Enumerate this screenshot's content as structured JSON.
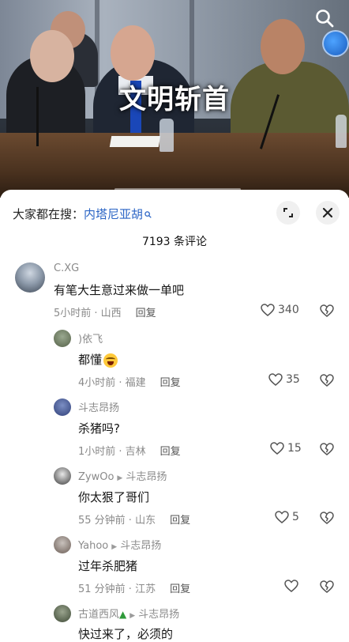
{
  "video": {
    "overlay_title": "文明斩首",
    "icons": [
      "search-icon",
      "avatar-badge"
    ]
  },
  "sheet": {
    "search_prefix": "大家都在搜：",
    "search_term": "内塔尼亚胡",
    "comment_count": "7193 条评论",
    "icons": [
      "expand-icon",
      "close-icon"
    ]
  },
  "comments": [
    {
      "user": "C.XG",
      "text": "有笔大生意过来做一单吧",
      "time": "5小时前 · 山西",
      "reply": "回复",
      "likes": "340"
    },
    {
      "user": ")依飞",
      "text": "都懂",
      "time": "4小时前 · 福建",
      "reply": "回复",
      "likes": "35"
    },
    {
      "user": "斗志昂扬",
      "text": "杀猪吗?",
      "time": "1小时前 · 吉林",
      "reply": "回复",
      "likes": "15"
    },
    {
      "user": "ZywOo",
      "reply_to": "斗志昂扬",
      "text": "你太狠了哥们",
      "time": "55 分钟前 · 山东",
      "reply": "回复",
      "likes": "5"
    },
    {
      "user": "Yahoo",
      "reply_to": "斗志昂扬",
      "text": "过年杀肥猪",
      "time": "51 分钟前 · 江苏",
      "reply": "回复",
      "likes": ""
    },
    {
      "user": "古道西风",
      "reply_to": "斗志昂扬",
      "text": "快过来了，必须的"
    }
  ],
  "colors": {
    "link_blue": "#2a64c5",
    "meta_gray": "#8a8a8a",
    "emoji_yellow": "#ffc93a"
  }
}
